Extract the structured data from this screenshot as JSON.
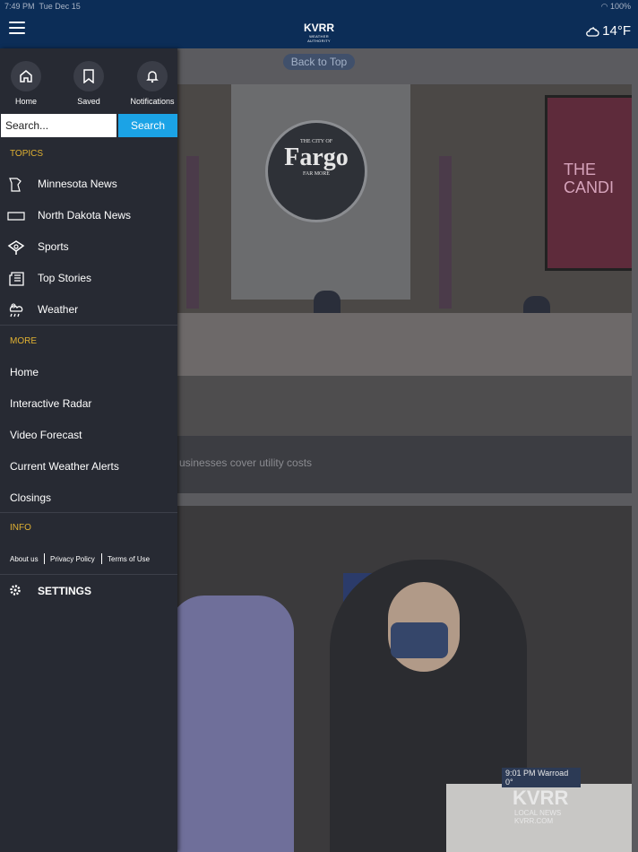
{
  "status": {
    "time": "7:49 PM",
    "date": "Tue Dec 15",
    "battery": "100%"
  },
  "header": {
    "logo": "KVRR",
    "logo_sub": "WEATHER AUTHORITY",
    "temperature": "14°F"
  },
  "drawer": {
    "quick": [
      {
        "label": "Home",
        "icon": "home-icon"
      },
      {
        "label": "Saved",
        "icon": "bookmark-icon"
      },
      {
        "label": "Notifications",
        "icon": "bell-icon"
      }
    ],
    "search": {
      "placeholder": "Search...",
      "button": "Search"
    },
    "topics_title": "TOPICS",
    "topics": [
      {
        "label": "Minnesota News",
        "icon": "minnesota-map-icon"
      },
      {
        "label": "North Dakota News",
        "icon": "north-dakota-map-icon"
      },
      {
        "label": "Sports",
        "icon": "sports-icon"
      },
      {
        "label": "Top Stories",
        "icon": "newspaper-icon"
      },
      {
        "label": "Weather",
        "icon": "weather-icon"
      }
    ],
    "more_title": "MORE",
    "more": [
      "Home",
      "Interactive Radar",
      "Video Forecast",
      "Current Weather Alerts",
      "Closings"
    ],
    "info_title": "INFO",
    "info": [
      "About us",
      "Privacy Policy",
      "Terms of Use"
    ],
    "settings": "SETTINGS"
  },
  "content": {
    "back_to_top": "Back to Top",
    "seal": {
      "top": "THE CITY OF",
      "main": "Fargo",
      "bottom": "FAR MORE"
    },
    "screen_text": "THE CANDI",
    "caption": "usinesses cover utility costs",
    "bug": {
      "time": "9:01 PM  Warroad  0°",
      "logo": "KVRR",
      "line1": "LOCAL NEWS",
      "line2": "KVRR.COM"
    }
  }
}
